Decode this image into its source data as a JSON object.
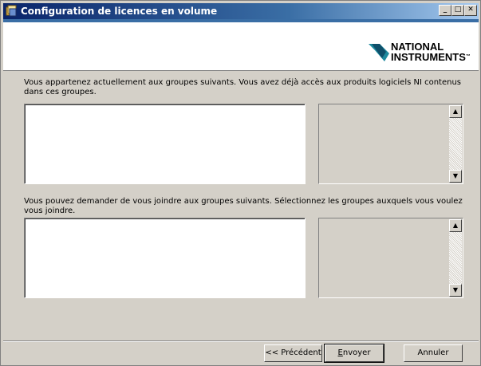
{
  "window": {
    "title": "Configuration de licences en volume",
    "controls": {
      "minimize": "_",
      "maximize": "□",
      "close": "✕"
    }
  },
  "logo": {
    "line1": "NATIONAL",
    "line2": "INSTRUMENTS",
    "trademark": "™",
    "icon": "ni-eagle-logo"
  },
  "section1": {
    "text": "Vous appartenez actuellement aux groupes suivants. Vous avez déjà accès aux produits logiciels NI contenus dans ces groupes."
  },
  "section2": {
    "text": "Vous pouvez demander de vous joindre aux groupes suivants. Sélectionnez les groupes auxquels vous voulez vous joindre."
  },
  "scroll": {
    "up_icon": "▲",
    "down_icon": "▼"
  },
  "buttons": {
    "previous": "<< Précédent",
    "send_first": "E",
    "send_rest": "nvoyer",
    "cancel": "Annuler"
  }
}
